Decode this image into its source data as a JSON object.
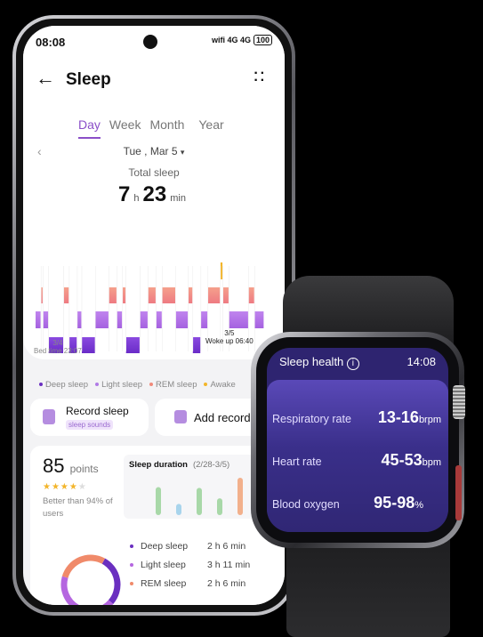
{
  "status": {
    "time": "08:08",
    "icons": "wifi 4G 4G",
    "battery": "100"
  },
  "header": {
    "title": "Sleep",
    "back_icon": "arrow-left-icon",
    "more_icon": "more-dots-icon"
  },
  "tabs": [
    {
      "label": "Day",
      "active": true
    },
    {
      "label": "Week"
    },
    {
      "label": "Month"
    },
    {
      "label": "Year"
    }
  ],
  "date": {
    "label": "Tue , Mar 5",
    "caret": "▾"
  },
  "total_sleep": {
    "label": "Total sleep",
    "hours": "7",
    "h": "h",
    "minutes": "23",
    "min": "min"
  },
  "hypnogram": {
    "start_date": "3/4",
    "start_label": "Bed time 23:07",
    "end_date": "3/5",
    "end_label": "Woke up 06:40",
    "segments": [
      [
        "light",
        11
      ],
      [
        "rem",
        4
      ],
      [
        "light",
        11
      ],
      [
        "deep",
        30
      ],
      [
        "rem",
        11
      ],
      [
        "deep",
        16
      ],
      [
        "light",
        9
      ],
      [
        "deep",
        27
      ],
      [
        "light",
        27
      ],
      [
        "rem",
        16
      ],
      [
        "light",
        11
      ],
      [
        "rem",
        7
      ],
      [
        "deep",
        28
      ],
      [
        "light",
        16
      ],
      [
        "rem",
        16
      ],
      [
        "light",
        12
      ],
      [
        "rem",
        27
      ],
      [
        "light",
        25
      ],
      [
        "rem",
        9
      ],
      [
        "deep",
        16
      ],
      [
        "light",
        14
      ],
      [
        "rem",
        25
      ],
      [
        "awake",
        5
      ],
      [
        "rem",
        12
      ],
      [
        "light",
        39
      ],
      [
        "rem",
        12
      ],
      [
        "light",
        19
      ]
    ]
  },
  "legend": [
    {
      "label": "Deep sleep",
      "color": "#6a2fc0"
    },
    {
      "label": "Light sleep",
      "color": "#b07ae6"
    },
    {
      "label": "REM sleep",
      "color": "#f08a7a"
    },
    {
      "label": "Awake",
      "color": "#f3b52a"
    }
  ],
  "actions": {
    "record_sleep": "Record sleep",
    "sleep_sounds": "sleep sounds",
    "add_record": "Add record"
  },
  "score": {
    "value": "85",
    "unit": "points",
    "stars": 4,
    "max_stars": 5,
    "comparison": "Better than 94% of users"
  },
  "duration": {
    "title": "Sleep duration",
    "range": "(2/28-3/5)",
    "partial_label": "23",
    "bars": [
      {
        "v": 0.75,
        "c": "#a8d8a8"
      },
      {
        "v": 0.3,
        "c": "#a8d4ec"
      },
      {
        "v": 0.73,
        "c": "#a8d8a8"
      },
      {
        "v": 0.45,
        "c": "#a8d8a8"
      },
      {
        "v": 1.0,
        "c": "#f2b08c"
      },
      {
        "v": 0.75,
        "c": "#a8d8a8"
      },
      {
        "v": 0.5,
        "c": "#a8d8a8"
      }
    ]
  },
  "stages": [
    {
      "label": "Deep sleep",
      "value": "2 h 6 min",
      "minutes": 126,
      "color": "#6a2fc0"
    },
    {
      "label": "Light sleep",
      "value": "3 h 11 min",
      "minutes": 191,
      "color": "#b566e0"
    },
    {
      "label": "REM sleep",
      "value": "2 h 6 min",
      "minutes": 126,
      "color": "#f08a6a"
    }
  ],
  "watch": {
    "title": "Sleep health",
    "info_icon": "info-icon",
    "time": "14:08",
    "rows": [
      {
        "label": "Respiratory rate",
        "value": "13-16",
        "unit": "brpm"
      },
      {
        "label": "Heart rate",
        "value": "45-53",
        "unit": "bpm"
      },
      {
        "label": "Blood oxygen",
        "value": "95-98",
        "unit": "%"
      }
    ]
  }
}
